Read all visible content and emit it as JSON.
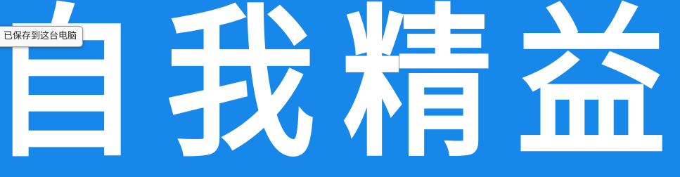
{
  "banner": {
    "background_color": "#1787e9",
    "text_color": "#ffffff",
    "title_chars": [
      "自",
      "我",
      "精",
      "益"
    ]
  },
  "toast": {
    "text": "已保存到这台电脑"
  }
}
